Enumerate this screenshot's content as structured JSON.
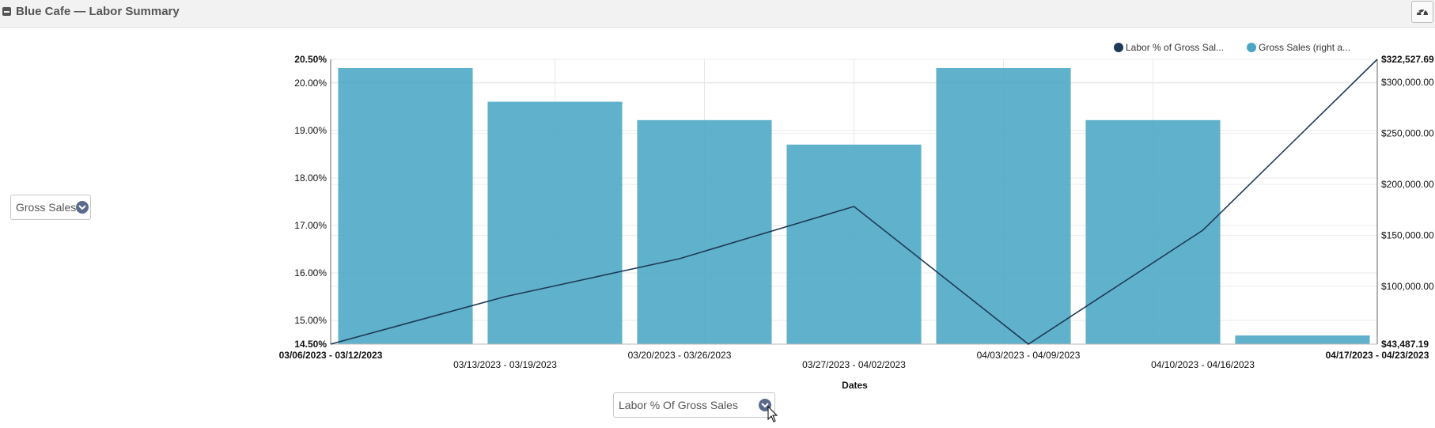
{
  "header": {
    "title": "Blue Cafe — Labor Summary"
  },
  "left_selector": {
    "value": "Gross Sales"
  },
  "bottom_selector": {
    "value": "Labor % Of Gross Sales"
  },
  "colors": {
    "bar": "#4aa6c4",
    "line": "#1d3a57",
    "header_bg": "#f2f2f2"
  },
  "chart_data": {
    "type": "bar",
    "xlabel": "Dates",
    "categories": [
      "03/06/2023 - 03/12/2023",
      "03/13/2023 - 03/19/2023",
      "03/20/2023 - 03/26/2023",
      "03/27/2023 - 04/02/2023",
      "04/03/2023 - 04/09/2023",
      "04/10/2023 - 04/16/2023",
      "04/17/2023 - 04/23/2023"
    ],
    "legend": {
      "placement": "top-right",
      "items": [
        "Labor % of Gross Sal...",
        "Gross Sales (right a..."
      ]
    },
    "series": [
      {
        "name": "Gross Sales (right a...",
        "type": "bar",
        "axis": "right",
        "values": [
          314000,
          281000,
          263000,
          239000,
          314000,
          263000,
          52000
        ]
      },
      {
        "name": "Labor % of Gross Sal...",
        "type": "line",
        "axis": "left",
        "values": [
          14.5,
          15.5,
          16.3,
          17.4,
          14.5,
          16.9,
          20.5
        ]
      }
    ],
    "left_axis": {
      "min": 14.5,
      "max": 20.5,
      "ticks": [
        14.5,
        15,
        16,
        17,
        18,
        19,
        20,
        20.5
      ],
      "tick_labels": [
        "14.50%",
        "15.00%",
        "16.00%",
        "17.00%",
        "18.00%",
        "19.00%",
        "20.00%",
        "20.50%"
      ]
    },
    "right_axis": {
      "min": 43487.19,
      "max": 322527.69,
      "ticks": [
        43487.19,
        100000,
        150000,
        200000,
        250000,
        300000,
        322527.69
      ],
      "tick_labels": [
        "$43,487.19",
        "$100,000.00",
        "$150,000.00",
        "$200,000.00",
        "$250,000.00",
        "$300,000.00",
        "$322,527.69"
      ]
    },
    "grid": true
  }
}
